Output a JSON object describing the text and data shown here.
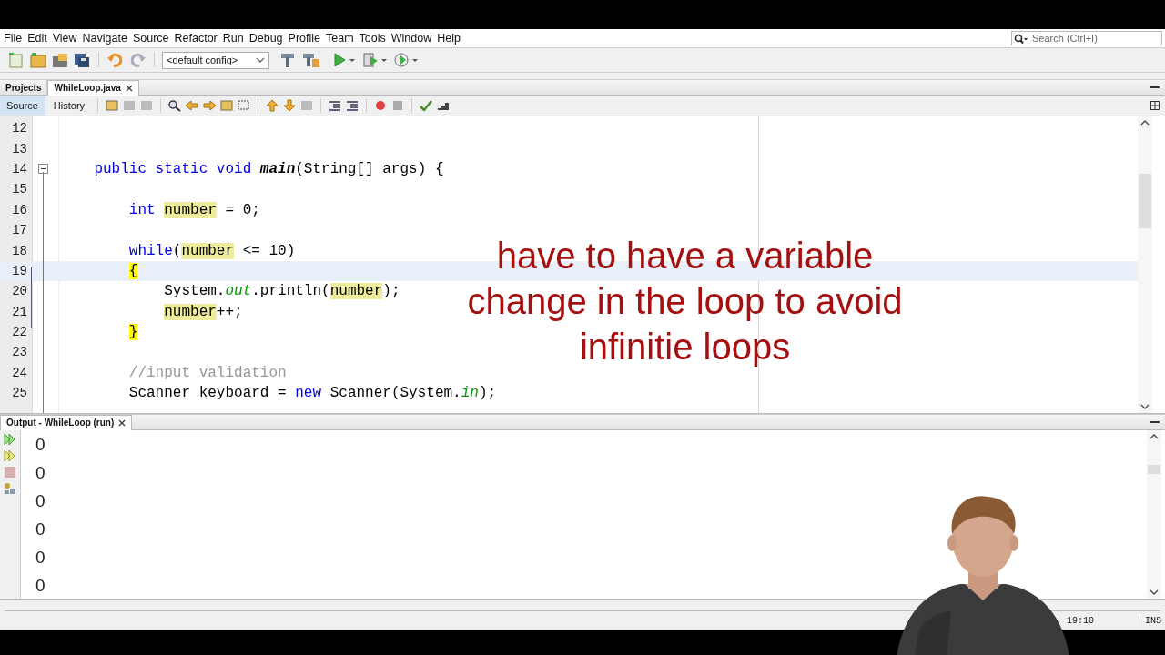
{
  "menu": [
    "File",
    "Edit",
    "View",
    "Navigate",
    "Source",
    "Refactor",
    "Run",
    "Debug",
    "Profile",
    "Team",
    "Tools",
    "Window",
    "Help"
  ],
  "search": {
    "placeholder": "Search (Ctrl+I)"
  },
  "config": {
    "value": "<default config>"
  },
  "editor_tabs": [
    {
      "label": "Projects",
      "selected": false,
      "closable": false
    },
    {
      "label": "WhileLoop.java",
      "selected": true,
      "closable": true
    }
  ],
  "view_tabs": [
    {
      "label": "Source",
      "selected": true
    },
    {
      "label": "History",
      "selected": false
    }
  ],
  "code": [
    {
      "number": "12",
      "current": false,
      "fold": false
    },
    {
      "number": "13",
      "current": false,
      "fold": false
    },
    {
      "number": "14",
      "current": false,
      "fold": true,
      "tokens": [
        {
          "text": "    public static void ",
          "kind": "keyword"
        },
        {
          "text": "main",
          "kind": "method"
        },
        {
          "text": "(String[] args) {",
          "kind": "plain"
        }
      ]
    },
    {
      "number": "15",
      "current": false,
      "fold": false
    },
    {
      "number": "16",
      "current": false,
      "fold": false,
      "tokens": [
        {
          "text": "        int ",
          "kind": "keyword"
        },
        {
          "text": "number",
          "kind": "occurrence"
        },
        {
          "text": " = 0;",
          "kind": "plain"
        }
      ]
    },
    {
      "number": "17",
      "current": false,
      "fold": false
    },
    {
      "number": "18",
      "current": false,
      "fold": false,
      "tokens": [
        {
          "text": "        while",
          "kind": "keyword"
        },
        {
          "text": "(",
          "kind": "plain"
        },
        {
          "text": "number",
          "kind": "occurrence"
        },
        {
          "text": " <= 10)",
          "kind": "plain"
        }
      ]
    },
    {
      "number": "19",
      "current": true,
      "fold": false,
      "tokens": [
        {
          "text": "        {",
          "kind": "brace"
        }
      ]
    },
    {
      "number": "20",
      "current": false,
      "fold": false,
      "tokens": [
        {
          "text": "            System.",
          "kind": "plain"
        },
        {
          "text": "out",
          "kind": "field"
        },
        {
          "text": ".println(",
          "kind": "plain"
        },
        {
          "text": "number",
          "kind": "occurrence"
        },
        {
          "text": ");",
          "kind": "plain"
        }
      ]
    },
    {
      "number": "21",
      "current": false,
      "fold": false,
      "tokens": [
        {
          "text": "            number",
          "kind": "occurrence"
        },
        {
          "text": "++;",
          "kind": "plain"
        }
      ]
    },
    {
      "number": "22",
      "current": false,
      "fold": false,
      "tokens": [
        {
          "text": "        }",
          "kind": "brace"
        }
      ]
    },
    {
      "number": "23",
      "current": false,
      "fold": false
    },
    {
      "number": "24",
      "current": false,
      "fold": false,
      "tokens": [
        {
          "text": "        //input validation",
          "kind": "comment"
        }
      ]
    },
    {
      "number": "25",
      "current": false,
      "fold": false,
      "tokens": [
        {
          "text": "        Scanner keyboard = ",
          "kind": "plain"
        },
        {
          "text": "new",
          "kind": "keyword"
        },
        {
          "text": " Scanner(System.",
          "kind": "plain"
        },
        {
          "text": "in",
          "kind": "field"
        },
        {
          "text": ");",
          "kind": "plain"
        }
      ]
    }
  ],
  "caption": "have to have a variable\nchange in the loop to avoid\ninfinitie loops",
  "output_tab": {
    "label": "Output - WhileLoop (run)"
  },
  "output_lines": [
    "0",
    "0",
    "0",
    "0",
    "0",
    "0"
  ],
  "status_bar": {
    "position": "19:10",
    "mode": "INS"
  },
  "webcam": {
    "kind": "picture"
  }
}
